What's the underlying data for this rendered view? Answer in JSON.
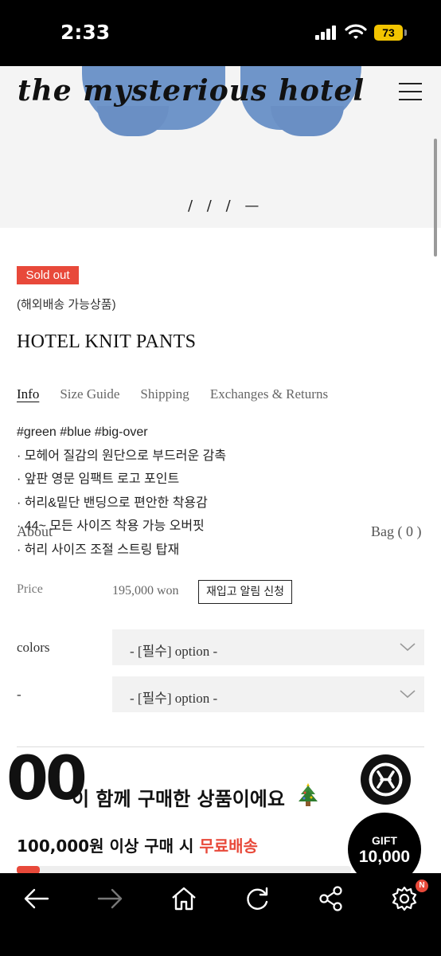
{
  "status_bar": {
    "time": "2:33",
    "battery": "73"
  },
  "header": {
    "logo": "the mysterious hotel",
    "slide_indicator": "/ / / —"
  },
  "product": {
    "badge": "Sold out",
    "overseas_note": "(해외배송 가능상품)",
    "name": "HOTEL KNIT PANTS",
    "tabs": [
      "Info",
      "Size Guide",
      "Shipping",
      "Exchanges & Returns"
    ],
    "description": [
      "#green #blue #big-over",
      "· 모헤어 질감의 원단으로 부드러운 감촉",
      "· 앞판 영문 임팩트 로고 포인트",
      "· 허리&밑단 밴딩으로 편안한 착용감",
      "· 44~ 모든 사이즈 착용 가능 오버핏",
      "· 허리 사이즈 조절 스트링 탑재"
    ],
    "price_label": "Price",
    "price": "195,000 won",
    "restock_button": "재입고 알림 신청"
  },
  "overlay_menu": {
    "about": "About",
    "bag": "Bag ( 0 )"
  },
  "options": [
    {
      "label": "colors",
      "value": "- [필수] option -"
    },
    {
      "label": "-",
      "value": "- [필수] option -"
    }
  ],
  "recommend": {
    "big_text": "00",
    "title": "이 함께 구매한 상품이에요",
    "shipping_amount": "100,000원",
    "shipping_text": " 이상 구매 시 ",
    "shipping_free": "무료배송",
    "progress_fraction": 0.07
  },
  "gift": {
    "label": "GIFT",
    "amount": "10,000"
  },
  "bottom_nav": {
    "badge": "N"
  },
  "colors": {
    "accent": "#e8493a"
  }
}
